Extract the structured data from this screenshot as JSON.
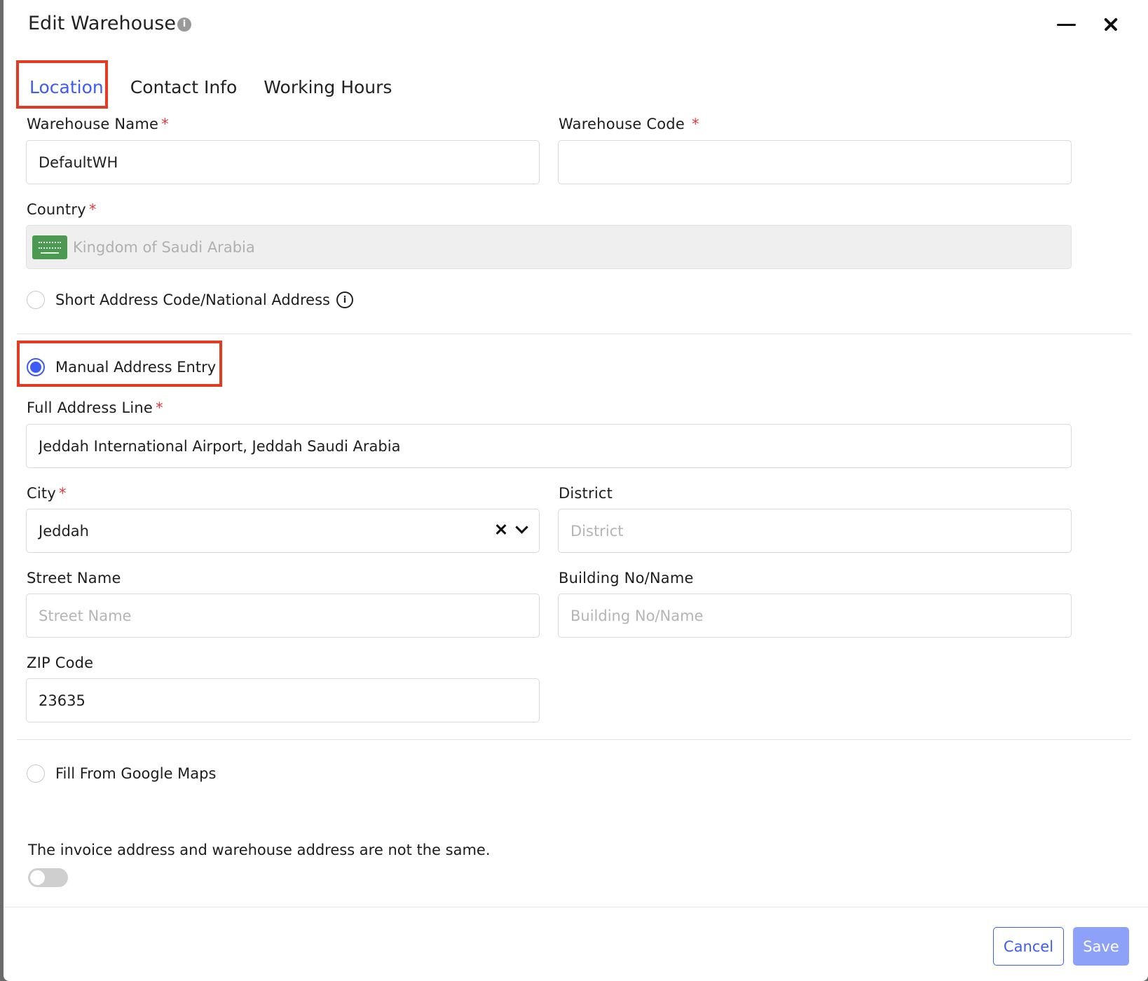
{
  "header": {
    "title": "Edit Warehouse",
    "info_glyph": "i"
  },
  "tabs": [
    {
      "label": "Location",
      "active": true
    },
    {
      "label": "Contact Info",
      "active": false
    },
    {
      "label": "Working Hours",
      "active": false
    }
  ],
  "form": {
    "warehouse_name": {
      "label": "Warehouse Name",
      "required_mark": "*",
      "value": "DefaultWH"
    },
    "warehouse_code": {
      "label": "Warehouse Code",
      "required_mark": "*",
      "value": ""
    },
    "country": {
      "label": "Country",
      "required_mark": "*",
      "value": "Kingdom of Saudi Arabia",
      "flag_icon": "saudi-arabia-flag-icon"
    },
    "short_address_option": {
      "label": "Short Address Code/National Address",
      "selected": false,
      "info_glyph": "i"
    },
    "manual_address_option": {
      "label": "Manual Address Entry",
      "selected": true
    },
    "full_address": {
      "label": "Full Address Line",
      "required_mark": "*",
      "value": "Jeddah International Airport, Jeddah Saudi Arabia"
    },
    "city": {
      "label": "City",
      "required_mark": "*",
      "value": "Jeddah"
    },
    "district": {
      "label": "District",
      "placeholder": "District",
      "value": ""
    },
    "street": {
      "label": "Street Name",
      "placeholder": "Street Name",
      "value": ""
    },
    "building": {
      "label": "Building No/Name",
      "placeholder": "Building No/Name",
      "value": ""
    },
    "zip": {
      "label": "ZIP Code",
      "value": "23635"
    },
    "google_maps_option": {
      "label": "Fill From Google Maps",
      "selected": false
    },
    "invoice_note": "The invoice address and warehouse address are not the same.",
    "invoice_toggle_on": false
  },
  "footer": {
    "cancel_label": "Cancel",
    "save_label": "Save"
  },
  "colors": {
    "accent": "#3d5cf5",
    "highlight": "#e43a22",
    "required": "#e0383e",
    "save_disabled": "#8ea1f8"
  }
}
